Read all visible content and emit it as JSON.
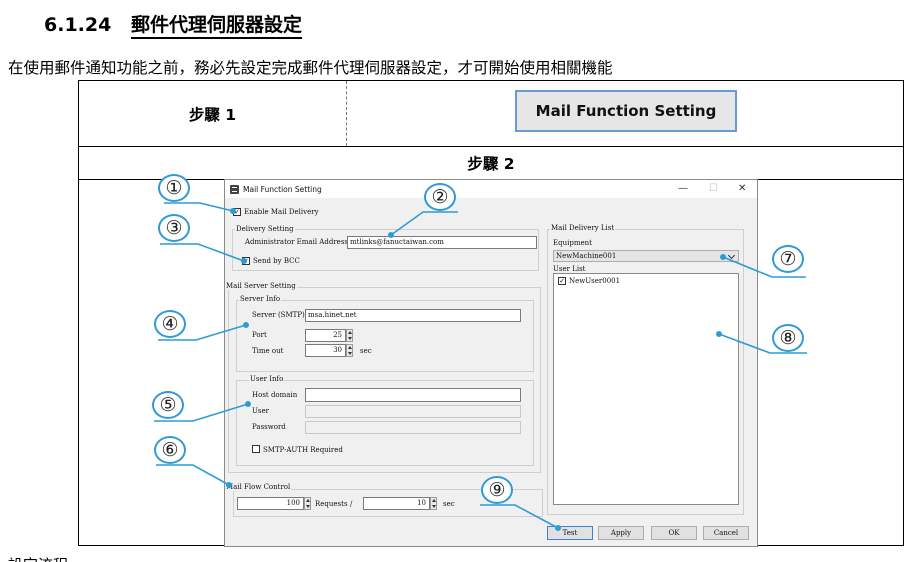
{
  "section": {
    "number": "6.1.24",
    "title": "郵件代理伺服器設定"
  },
  "intro": "在使用郵件通知功能之前，務必先設定完成郵件代理伺服器設定，才可開始使用相關機能",
  "outro": "設定流程",
  "steps": {
    "step1_label": "步驟 1",
    "step1_button": "Mail Function Setting",
    "step2_label": "步驟 2"
  },
  "dialog": {
    "title": "Mail Function Setting",
    "window_buttons": {
      "minimize": "—",
      "maximize": "☐",
      "close": "✕"
    },
    "enable_delivery": {
      "label": "Enable Mail Delivery",
      "checked": true
    },
    "delivery_setting": {
      "group": "Delivery Setting",
      "admin_email_label": "Administrator Email Address",
      "admin_email_value": "mtlinks@fanuctaiwan.com",
      "send_bcc": {
        "label": "Send by BCC",
        "checked": true
      }
    },
    "mail_server_setting": {
      "group": "Mail Server Setting",
      "server_info": {
        "group": "Server Info",
        "server_label": "Server (SMTP)",
        "server_value": "msa.hinet.net",
        "port_label": "Port",
        "port_value": "25",
        "timeout_label": "Time out",
        "timeout_value": "30",
        "timeout_unit": "sec"
      },
      "user_info": {
        "group": "User Info",
        "host_label": "Host domain",
        "host_value": "",
        "user_label": "User",
        "user_value": "",
        "password_label": "Password",
        "password_value": "",
        "smtp_auth": {
          "label": "SMTP-AUTH Required",
          "checked": false
        }
      }
    },
    "mail_flow": {
      "group": "Mail Flow Control",
      "requests_value": "100",
      "requests_label": "Requests",
      "slash": "/",
      "seconds_value": "10",
      "seconds_unit": "sec"
    },
    "delivery_list": {
      "group": "Mail Delivery List",
      "equipment_label": "Equipment",
      "equipment_value": "NewMachine001",
      "user_list_label": "User List",
      "users": [
        {
          "name": "NewUser0001",
          "checked": true
        }
      ]
    },
    "buttons": {
      "test": "Test",
      "apply": "Apply",
      "ok": "OK",
      "cancel": "Cancel"
    }
  },
  "callouts": [
    "①",
    "②",
    "③",
    "④",
    "⑤",
    "⑥",
    "⑦",
    "⑧",
    "⑨"
  ],
  "colors": {
    "callout": "#2e9bd6",
    "step_button_border": "#6a9ad2",
    "default_button_border": "#3c7fd8"
  },
  "icons": {
    "checkbox_check": "✓"
  }
}
